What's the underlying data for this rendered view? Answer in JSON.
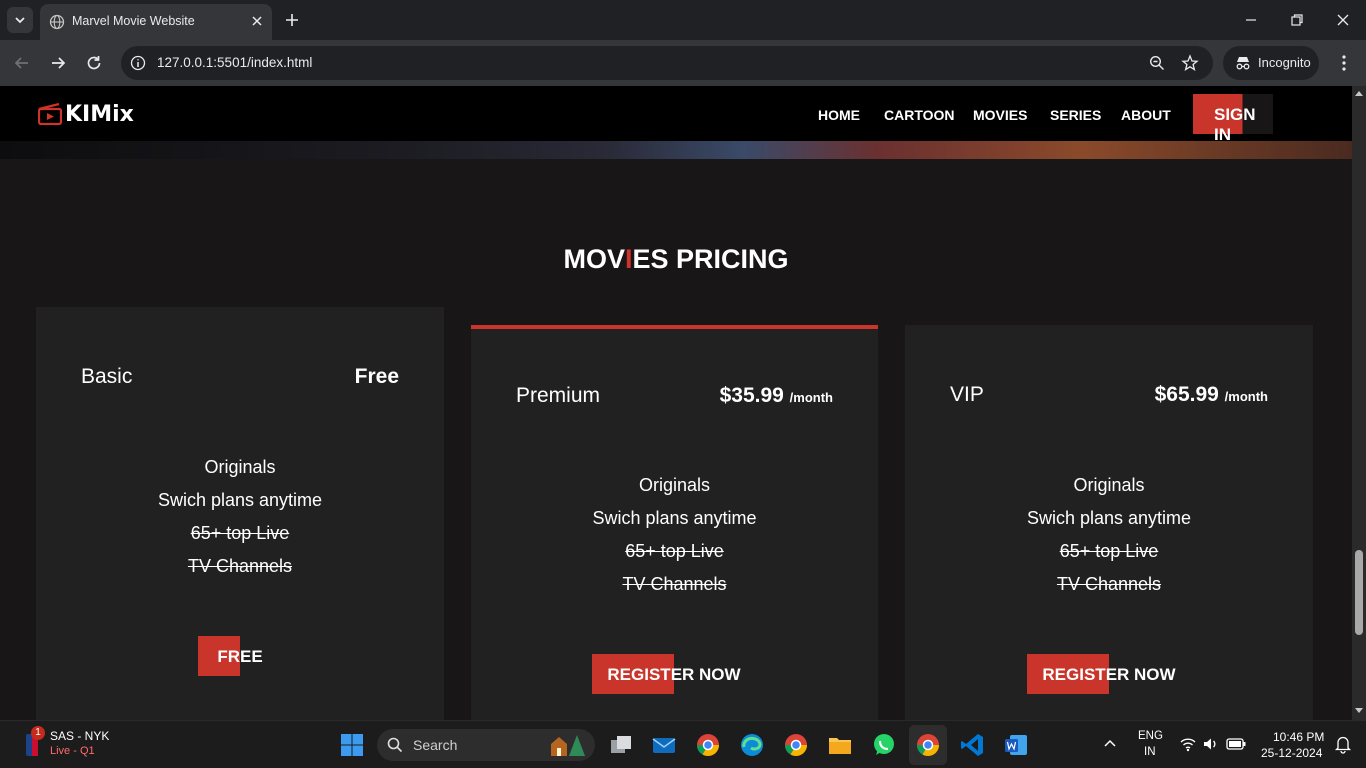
{
  "browser": {
    "tab_title": "Marvel Movie Website",
    "url": "127.0.0.1:5501/index.html",
    "incognito_label": "Incognito"
  },
  "site": {
    "logo_text": "KIMix",
    "nav": [
      "HOME",
      "CARTOON",
      "MOVIES",
      "SERIES",
      "ABOUT"
    ],
    "signin_label": "SIGN IN",
    "section_title_pre": "MOV",
    "section_title_accent": "I",
    "section_title_post": "ES PRICING",
    "accent_color": "#c9342b",
    "plans": [
      {
        "name": "Basic",
        "price": "Free",
        "per": "",
        "features": [
          "Originals",
          "Swich plans anytime",
          "65+ top Live",
          "TV Channels"
        ],
        "cta": "FREE"
      },
      {
        "name": "Premium",
        "price": "$35.99",
        "per": "/month",
        "features": [
          "Originals",
          "Swich plans anytime",
          "65+ top Live",
          "TV Channels"
        ],
        "cta": "REGISTER NOW"
      },
      {
        "name": "VIP",
        "price": "$65.99",
        "per": "/month",
        "features": [
          "Originals",
          "Swich plans anytime",
          "65+ top Live",
          "TV Channels"
        ],
        "cta": "REGISTER NOW"
      }
    ]
  },
  "taskbar": {
    "score_title": "SAS - NYK",
    "score_status": "Live - Q1",
    "notif_count": "1",
    "search_label": "Search",
    "lang_line1": "ENG",
    "lang_line2": "IN",
    "time": "10:46 PM",
    "date": "25-12-2024"
  }
}
